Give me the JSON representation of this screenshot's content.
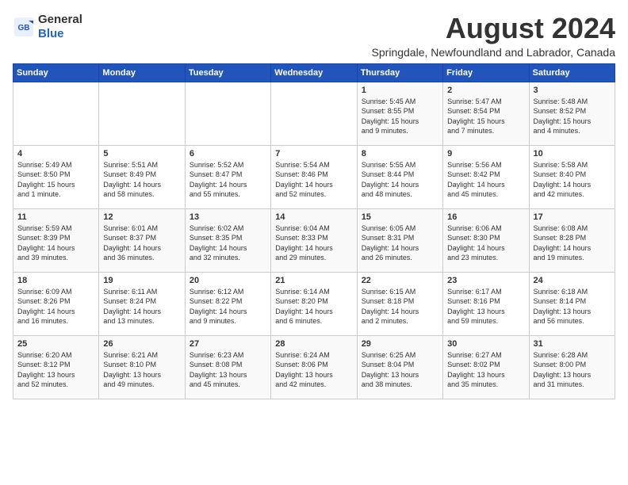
{
  "logo": {
    "general": "General",
    "blue": "Blue"
  },
  "title": {
    "month_year": "August 2024",
    "location": "Springdale, Newfoundland and Labrador, Canada"
  },
  "weekdays": [
    "Sunday",
    "Monday",
    "Tuesday",
    "Wednesday",
    "Thursday",
    "Friday",
    "Saturday"
  ],
  "weeks": [
    [
      {
        "day": "",
        "info": ""
      },
      {
        "day": "",
        "info": ""
      },
      {
        "day": "",
        "info": ""
      },
      {
        "day": "",
        "info": ""
      },
      {
        "day": "1",
        "info": "Sunrise: 5:45 AM\nSunset: 8:55 PM\nDaylight: 15 hours\nand 9 minutes."
      },
      {
        "day": "2",
        "info": "Sunrise: 5:47 AM\nSunset: 8:54 PM\nDaylight: 15 hours\nand 7 minutes."
      },
      {
        "day": "3",
        "info": "Sunrise: 5:48 AM\nSunset: 8:52 PM\nDaylight: 15 hours\nand 4 minutes."
      }
    ],
    [
      {
        "day": "4",
        "info": "Sunrise: 5:49 AM\nSunset: 8:50 PM\nDaylight: 15 hours\nand 1 minute."
      },
      {
        "day": "5",
        "info": "Sunrise: 5:51 AM\nSunset: 8:49 PM\nDaylight: 14 hours\nand 58 minutes."
      },
      {
        "day": "6",
        "info": "Sunrise: 5:52 AM\nSunset: 8:47 PM\nDaylight: 14 hours\nand 55 minutes."
      },
      {
        "day": "7",
        "info": "Sunrise: 5:54 AM\nSunset: 8:46 PM\nDaylight: 14 hours\nand 52 minutes."
      },
      {
        "day": "8",
        "info": "Sunrise: 5:55 AM\nSunset: 8:44 PM\nDaylight: 14 hours\nand 48 minutes."
      },
      {
        "day": "9",
        "info": "Sunrise: 5:56 AM\nSunset: 8:42 PM\nDaylight: 14 hours\nand 45 minutes."
      },
      {
        "day": "10",
        "info": "Sunrise: 5:58 AM\nSunset: 8:40 PM\nDaylight: 14 hours\nand 42 minutes."
      }
    ],
    [
      {
        "day": "11",
        "info": "Sunrise: 5:59 AM\nSunset: 8:39 PM\nDaylight: 14 hours\nand 39 minutes."
      },
      {
        "day": "12",
        "info": "Sunrise: 6:01 AM\nSunset: 8:37 PM\nDaylight: 14 hours\nand 36 minutes."
      },
      {
        "day": "13",
        "info": "Sunrise: 6:02 AM\nSunset: 8:35 PM\nDaylight: 14 hours\nand 32 minutes."
      },
      {
        "day": "14",
        "info": "Sunrise: 6:04 AM\nSunset: 8:33 PM\nDaylight: 14 hours\nand 29 minutes."
      },
      {
        "day": "15",
        "info": "Sunrise: 6:05 AM\nSunset: 8:31 PM\nDaylight: 14 hours\nand 26 minutes."
      },
      {
        "day": "16",
        "info": "Sunrise: 6:06 AM\nSunset: 8:30 PM\nDaylight: 14 hours\nand 23 minutes."
      },
      {
        "day": "17",
        "info": "Sunrise: 6:08 AM\nSunset: 8:28 PM\nDaylight: 14 hours\nand 19 minutes."
      }
    ],
    [
      {
        "day": "18",
        "info": "Sunrise: 6:09 AM\nSunset: 8:26 PM\nDaylight: 14 hours\nand 16 minutes."
      },
      {
        "day": "19",
        "info": "Sunrise: 6:11 AM\nSunset: 8:24 PM\nDaylight: 14 hours\nand 13 minutes."
      },
      {
        "day": "20",
        "info": "Sunrise: 6:12 AM\nSunset: 8:22 PM\nDaylight: 14 hours\nand 9 minutes."
      },
      {
        "day": "21",
        "info": "Sunrise: 6:14 AM\nSunset: 8:20 PM\nDaylight: 14 hours\nand 6 minutes."
      },
      {
        "day": "22",
        "info": "Sunrise: 6:15 AM\nSunset: 8:18 PM\nDaylight: 14 hours\nand 2 minutes."
      },
      {
        "day": "23",
        "info": "Sunrise: 6:17 AM\nSunset: 8:16 PM\nDaylight: 13 hours\nand 59 minutes."
      },
      {
        "day": "24",
        "info": "Sunrise: 6:18 AM\nSunset: 8:14 PM\nDaylight: 13 hours\nand 56 minutes."
      }
    ],
    [
      {
        "day": "25",
        "info": "Sunrise: 6:20 AM\nSunset: 8:12 PM\nDaylight: 13 hours\nand 52 minutes."
      },
      {
        "day": "26",
        "info": "Sunrise: 6:21 AM\nSunset: 8:10 PM\nDaylight: 13 hours\nand 49 minutes."
      },
      {
        "day": "27",
        "info": "Sunrise: 6:23 AM\nSunset: 8:08 PM\nDaylight: 13 hours\nand 45 minutes."
      },
      {
        "day": "28",
        "info": "Sunrise: 6:24 AM\nSunset: 8:06 PM\nDaylight: 13 hours\nand 42 minutes."
      },
      {
        "day": "29",
        "info": "Sunrise: 6:25 AM\nSunset: 8:04 PM\nDaylight: 13 hours\nand 38 minutes."
      },
      {
        "day": "30",
        "info": "Sunrise: 6:27 AM\nSunset: 8:02 PM\nDaylight: 13 hours\nand 35 minutes."
      },
      {
        "day": "31",
        "info": "Sunrise: 6:28 AM\nSunset: 8:00 PM\nDaylight: 13 hours\nand 31 minutes."
      }
    ]
  ]
}
